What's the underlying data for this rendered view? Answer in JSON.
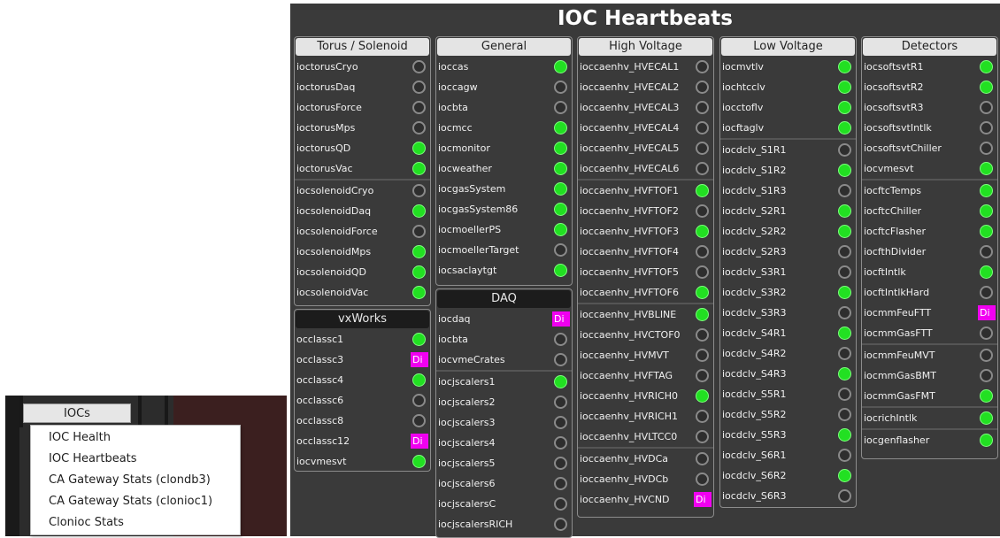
{
  "app": {
    "title": "IOC Heartbeats",
    "colors": {
      "led_on": "#22e022",
      "led_off": "#8a8a8a",
      "disconnected": "#f000f0",
      "panel_bg": "#3a3a3a"
    }
  },
  "menu": {
    "button_label": "IOCs",
    "items": [
      "IOC Health",
      "IOC Heartbeats",
      "CA Gateway Stats (clondb3)",
      "CA Gateway Stats (clonioc1)",
      "Clonioc Stats"
    ]
  },
  "groups": [
    {
      "title": "Torus / Solenoid",
      "header_style": "light",
      "rows": [
        {
          "name": "ioctorusCryo",
          "status": "off"
        },
        {
          "name": "ioctorusDaq",
          "status": "off"
        },
        {
          "name": "ioctorusForce",
          "status": "off"
        },
        {
          "name": "ioctorusMps",
          "status": "off"
        },
        {
          "name": "ioctorusQD",
          "status": "on"
        },
        {
          "name": "ioctorusVac",
          "status": "on"
        },
        {
          "name": "iocsolenoidCryo",
          "status": "off",
          "sep": true
        },
        {
          "name": "iocsolenoidDaq",
          "status": "on"
        },
        {
          "name": "iocsolenoidForce",
          "status": "off"
        },
        {
          "name": "iocsolenoidMps",
          "status": "on"
        },
        {
          "name": "iocsolenoidQD",
          "status": "on"
        },
        {
          "name": "iocsolenoidVac",
          "status": "on"
        }
      ]
    },
    {
      "title": "vxWorks",
      "header_style": "dark",
      "rows": [
        {
          "name": "occlassc1",
          "status": "on"
        },
        {
          "name": "occlassc3",
          "status": "dis",
          "dis_text": "Di"
        },
        {
          "name": "occlassc4",
          "status": "on"
        },
        {
          "name": "occlassc6",
          "status": "off"
        },
        {
          "name": "occlassc8",
          "status": "off"
        },
        {
          "name": "occlassc12",
          "status": "dis",
          "dis_text": "Di"
        },
        {
          "name": "iocvmesvt",
          "status": "on"
        }
      ]
    },
    {
      "title": "General",
      "header_style": "light",
      "rows": [
        {
          "name": "ioccas",
          "status": "on"
        },
        {
          "name": "ioccagw",
          "status": "off"
        },
        {
          "name": "iocbta",
          "status": "off"
        },
        {
          "name": "iocmcc",
          "status": "on"
        },
        {
          "name": "iocmonitor",
          "status": "on"
        },
        {
          "name": "iocweather",
          "status": "on"
        },
        {
          "name": "iocgasSystem",
          "status": "on"
        },
        {
          "name": "iocgasSystem86",
          "status": "on"
        },
        {
          "name": "iocmoellerPS",
          "status": "on"
        },
        {
          "name": "iocmoellerTarget",
          "status": "off"
        },
        {
          "name": "iocsaclaytgt",
          "status": "on"
        }
      ]
    },
    {
      "title": "DAQ",
      "header_style": "dark",
      "rows": [
        {
          "name": "iocdaq",
          "status": "dis",
          "dis_text": "Di"
        },
        {
          "name": "iocbta",
          "status": "off"
        },
        {
          "name": "iocvmeCrates",
          "status": "off"
        },
        {
          "name": "iocjscalers1",
          "status": "on",
          "sep": true
        },
        {
          "name": "iocjscalers2",
          "status": "off"
        },
        {
          "name": "iocjscalers3",
          "status": "off"
        },
        {
          "name": "iocjscalers4",
          "status": "off"
        },
        {
          "name": "iocjscalers5",
          "status": "off"
        },
        {
          "name": "iocjscalers6",
          "status": "off"
        },
        {
          "name": "iocjscalersC",
          "status": "off"
        },
        {
          "name": "iocjscalersRICH",
          "status": "off"
        }
      ]
    },
    {
      "title": "High Voltage",
      "header_style": "light",
      "rows": [
        {
          "name": "ioccaenhv_HVECAL1",
          "status": "off"
        },
        {
          "name": "ioccaenhv_HVECAL2",
          "status": "off"
        },
        {
          "name": "ioccaenhv_HVECAL3",
          "status": "off"
        },
        {
          "name": "ioccaenhv_HVECAL4",
          "status": "off"
        },
        {
          "name": "ioccaenhv_HVECAL5",
          "status": "off"
        },
        {
          "name": "ioccaenhv_HVECAL6",
          "status": "off"
        },
        {
          "name": "ioccaenhv_HVFTOF1",
          "status": "on",
          "sep": true
        },
        {
          "name": "ioccaenhv_HVFTOF2",
          "status": "off"
        },
        {
          "name": "ioccaenhv_HVFTOF3",
          "status": "on"
        },
        {
          "name": "ioccaenhv_HVFTOF4",
          "status": "off"
        },
        {
          "name": "ioccaenhv_HVFTOF5",
          "status": "off"
        },
        {
          "name": "ioccaenhv_HVFTOF6",
          "status": "on"
        },
        {
          "name": "ioccaenhv_HVBLINE",
          "status": "on",
          "sep": true
        },
        {
          "name": "ioccaenhv_HVCTOF0",
          "status": "off"
        },
        {
          "name": "ioccaenhv_HVMVT",
          "status": "off"
        },
        {
          "name": "ioccaenhv_HVFTAG",
          "status": "off"
        },
        {
          "name": "ioccaenhv_HVRICH0",
          "status": "on"
        },
        {
          "name": "ioccaenhv_HVRICH1",
          "status": "off"
        },
        {
          "name": "ioccaenhv_HVLTCC0",
          "status": "off"
        },
        {
          "name": "ioccaenhv_HVDCa",
          "status": "off",
          "sep": true
        },
        {
          "name": "ioccaenhv_HVDCb",
          "status": "off"
        },
        {
          "name": "ioccaenhv_HVCND",
          "status": "dis",
          "dis_text": "Di"
        }
      ]
    },
    {
      "title": "Low Voltage",
      "header_style": "light",
      "rows": [
        {
          "name": "iocmvtlv",
          "status": "on"
        },
        {
          "name": "iochtcclv",
          "status": "on"
        },
        {
          "name": "iocctoflv",
          "status": "on"
        },
        {
          "name": "iocftaglv",
          "status": "on"
        },
        {
          "name": "iocdclv_S1R1",
          "status": "off",
          "sep": true
        },
        {
          "name": "iocdclv_S1R2",
          "status": "on"
        },
        {
          "name": "iocdclv_S1R3",
          "status": "off"
        },
        {
          "name": "iocdclv_S2R1",
          "status": "on"
        },
        {
          "name": "iocdclv_S2R2",
          "status": "on"
        },
        {
          "name": "iocdclv_S2R3",
          "status": "off"
        },
        {
          "name": "iocdclv_S3R1",
          "status": "off"
        },
        {
          "name": "iocdclv_S3R2",
          "status": "on"
        },
        {
          "name": "iocdclv_S3R3",
          "status": "off"
        },
        {
          "name": "iocdclv_S4R1",
          "status": "on"
        },
        {
          "name": "iocdclv_S4R2",
          "status": "off"
        },
        {
          "name": "iocdclv_S4R3",
          "status": "on"
        },
        {
          "name": "iocdclv_S5R1",
          "status": "off"
        },
        {
          "name": "iocdclv_S5R2",
          "status": "off"
        },
        {
          "name": "iocdclv_S5R3",
          "status": "on"
        },
        {
          "name": "iocdclv_S6R1",
          "status": "off"
        },
        {
          "name": "iocdclv_S6R2",
          "status": "on"
        },
        {
          "name": "iocdclv_S6R3",
          "status": "off"
        }
      ]
    },
    {
      "title": "Detectors",
      "header_style": "light",
      "rows": [
        {
          "name": "iocsoftsvtR1",
          "status": "on"
        },
        {
          "name": "iocsoftsvtR2",
          "status": "on"
        },
        {
          "name": "iocsoftsvtR3",
          "status": "off"
        },
        {
          "name": "iocsoftsvtIntlk",
          "status": "off"
        },
        {
          "name": "iocsoftsvtChiller",
          "status": "off"
        },
        {
          "name": "iocvmesvt",
          "status": "on"
        },
        {
          "name": "iocftcTemps",
          "status": "on",
          "sep": true
        },
        {
          "name": "iocftcChiller",
          "status": "on"
        },
        {
          "name": "iocftcFlasher",
          "status": "on"
        },
        {
          "name": "iocfthDivider",
          "status": "off"
        },
        {
          "name": "iocftIntlk",
          "status": "on"
        },
        {
          "name": "iocftIntlkHard",
          "status": "off"
        },
        {
          "name": "iocmmFeuFTT",
          "status": "dis",
          "dis_text": "Di"
        },
        {
          "name": "iocmmGasFTT",
          "status": "off"
        },
        {
          "name": "iocmmFeuMVT",
          "status": "off",
          "sep": true
        },
        {
          "name": "iocmmGasBMT",
          "status": "off"
        },
        {
          "name": "iocmmGasFMT",
          "status": "on"
        },
        {
          "name": "iocrichIntlk",
          "status": "on",
          "sep": true
        },
        {
          "name": "iocgenflasher",
          "status": "on",
          "sep": true
        }
      ]
    }
  ]
}
